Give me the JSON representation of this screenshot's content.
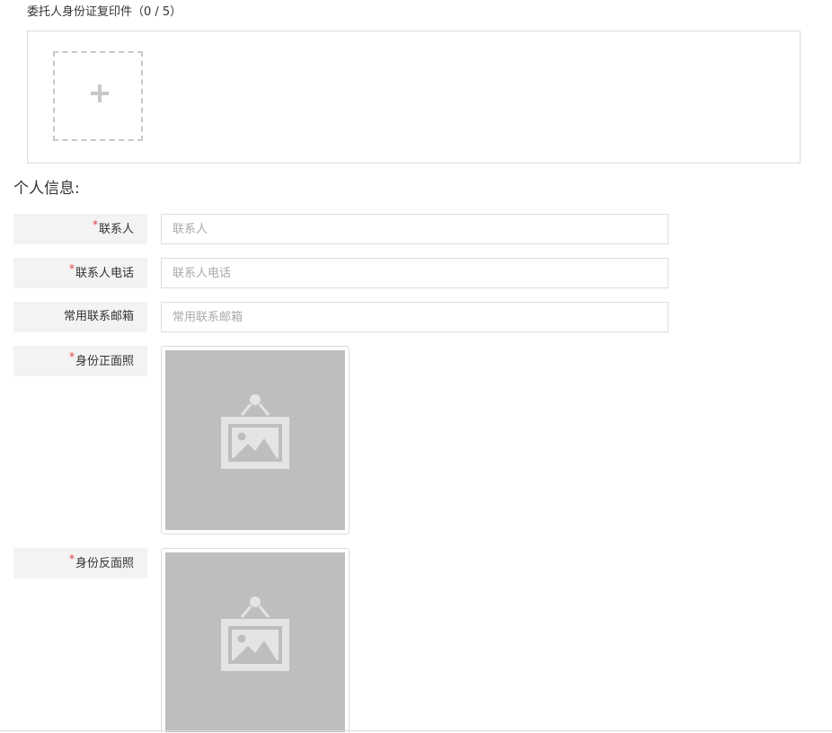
{
  "upload": {
    "title": "委托人身份证复印件（0 / 5）"
  },
  "personal": {
    "section_title": "个人信息:",
    "required_mark": "*",
    "contact": {
      "label": "联系人",
      "placeholder": "联系人",
      "value": ""
    },
    "phone": {
      "label": "联系人电话",
      "placeholder": "联系人电话",
      "value": ""
    },
    "email": {
      "label": "常用联系邮箱",
      "placeholder": "常用联系邮箱",
      "value": ""
    },
    "id_front": {
      "label": "身份正面照"
    },
    "id_back": {
      "label": "身份反面照"
    }
  },
  "icons": {
    "add": "plus-icon",
    "photo_placeholder": "image-placeholder-icon"
  },
  "colors": {
    "required": "#e4393c",
    "label_bg": "#f3f3f3",
    "border": "#dddddd",
    "placeholder_bg": "#bdbebf"
  }
}
